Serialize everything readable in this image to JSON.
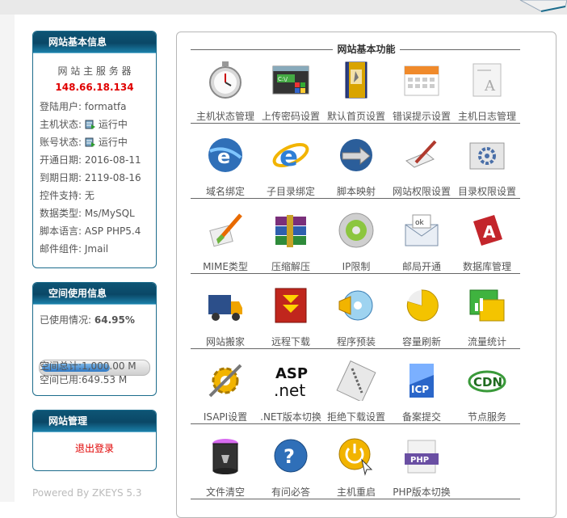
{
  "left": {
    "site_info": {
      "title": "网站基本信息",
      "server_label": "网 站 主 服 务 器",
      "ip": "148.66.18.134",
      "user_label": "登陆用户:",
      "user": "formatfa",
      "host_status_label": "主机状态:",
      "host_status": "运行中",
      "account_status_label": "账号状态:",
      "account_status": "运行中",
      "open_date_label": "开通日期:",
      "open_date": "2016-08-11",
      "expire_date_label": "到期日期:",
      "expire_date": "2119-08-16",
      "control_label": "控件支持:",
      "control": "无",
      "db_label": "数据类型:",
      "db": "Ms/MySQL",
      "script_label": "脚本语言:",
      "script": "ASP PHP5.4",
      "mail_label": "邮件组件:",
      "mail": "Jmail"
    },
    "space_info": {
      "title": "空间使用信息",
      "used_label": "已使用情况:",
      "used_percent": "64.95%",
      "usage_fraction": 0.6495,
      "total": "空间总计:1,000.00 M",
      "used": "空间已用:649.53 M"
    },
    "site_mgmt": {
      "title": "网站管理",
      "logout": "退出登录"
    },
    "powered_by": "Powered By ZKEYS 5.3"
  },
  "main": {
    "title": "网站基本功能",
    "rows": [
      [
        {
          "label": "主机状态管理",
          "icon": "stopwatch-icon"
        },
        {
          "label": "上传密码设置",
          "icon": "ftp-window-icon"
        },
        {
          "label": "默认首页设置",
          "icon": "book-icon"
        },
        {
          "label": "错误提示设置",
          "icon": "calendar-icon"
        },
        {
          "label": "主机日志管理",
          "icon": "document-icon"
        }
      ],
      [
        {
          "label": "域名绑定",
          "icon": "ie-globe-icon"
        },
        {
          "label": "子目录绑定",
          "icon": "ie-icon"
        },
        {
          "label": "脚本映射",
          "icon": "globe-arrows-icon"
        },
        {
          "label": "网站权限设置",
          "icon": "pen-tool-icon"
        },
        {
          "label": "目录权限设置",
          "icon": "folder-gear-icon"
        }
      ],
      [
        {
          "label": "MIME类型",
          "icon": "brush-icon"
        },
        {
          "label": "压缩解压",
          "icon": "winrar-books-icon"
        },
        {
          "label": "IP限制",
          "icon": "disc-button-icon"
        },
        {
          "label": "邮局开通",
          "icon": "envelope-ok-icon"
        },
        {
          "label": "数据库管理",
          "icon": "access-icon"
        }
      ],
      [
        {
          "label": "网站搬家",
          "icon": "truck-icon"
        },
        {
          "label": "远程下载",
          "icon": "download-arrow-icon"
        },
        {
          "label": "程序预装",
          "icon": "cd-install-icon"
        },
        {
          "label": "容量刷新",
          "icon": "pie-icon"
        },
        {
          "label": "流量统计",
          "icon": "chart-window-icon"
        }
      ],
      [
        {
          "label": "ISAPI设置",
          "icon": "gear-tools-icon"
        },
        {
          "label": ".NET版本切换",
          "icon": "asp-net-icon"
        },
        {
          "label": "拒绝下载设置",
          "icon": "zip-file-icon"
        },
        {
          "label": "备案提交",
          "icon": "icp-icon"
        },
        {
          "label": "节点服务",
          "icon": "cdn-icon"
        }
      ],
      [
        {
          "label": "文件清空",
          "icon": "trash-can-icon"
        },
        {
          "label": "有问必答",
          "icon": "question-icon"
        },
        {
          "label": "主机重启",
          "icon": "power-cursor-icon"
        },
        {
          "label": "PHP版本切换",
          "icon": "php-icon"
        }
      ]
    ]
  }
}
